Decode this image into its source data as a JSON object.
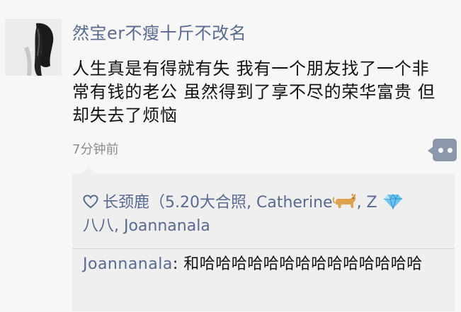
{
  "post": {
    "username": "然宝er不瘦十斤不改名",
    "content": "人生真是有得就有失 我有一个朋友找了一个非常有钱的老公 虽然得到了享不尽的荣华富贵 但却失去了烦恼",
    "time": "7分钟前"
  },
  "likes": {
    "part1": "长颈鹿（5.20大合照, Catherine",
    "part2": ", Z",
    "part3": "八八, Joannanala"
  },
  "comment": {
    "author": "Joannanala",
    "separator": ": ",
    "text": "和哈哈哈哈哈哈哈哈哈哈哈哈哈哈"
  },
  "colors": {
    "link": "#586a92",
    "more_button": "#8a98aa",
    "background": "#f7f7f7",
    "panel": "#efefef"
  },
  "icons": [
    "heart-outline-icon",
    "cat-emoji-icon",
    "diamond-emoji-icon",
    "more-comment-icon"
  ]
}
